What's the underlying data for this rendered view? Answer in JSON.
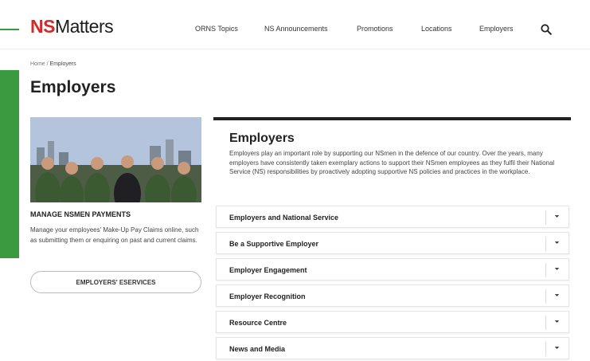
{
  "logo": {
    "ns": "NS",
    "matters": "Matters"
  },
  "nav": {
    "items": [
      "ORNS Topics",
      "NS Announcements",
      "Promotions",
      "Locations",
      "Employers"
    ]
  },
  "breadcrumb": {
    "home": "Home",
    "separator": "/",
    "current": "Employers"
  },
  "page_title": "Employers",
  "promo": {
    "title": "MANAGE NSMEN PAYMENTS",
    "text": "Manage your employees' Make-Up Pay Claims online, such as submitting them or enquiring on past and current claims.",
    "button_label": "EMPLOYERS' ESERVICES"
  },
  "main": {
    "title": "Employers",
    "description": "Employers play an important role by supporting our NSmen in the defence of our country. Over the years, many employers have consistently taken exemplary actions to support their NSmen employees as they fulfil their National Service (NS) responsibilities by proactively adopting supportive NS policies and practices in the workplace.",
    "accordion": [
      {
        "label": "Employers and National Service"
      },
      {
        "label": "Be a Supportive Employer"
      },
      {
        "label": "Employer Engagement"
      },
      {
        "label": "Employer Recognition"
      },
      {
        "label": "Resource Centre"
      },
      {
        "label": "News and Media"
      }
    ]
  },
  "colors": {
    "brand_red": "#d62828",
    "accent_green": "#3a9a3f"
  },
  "icons": {
    "search": "search-icon",
    "chevron": "chevron-down-icon"
  }
}
